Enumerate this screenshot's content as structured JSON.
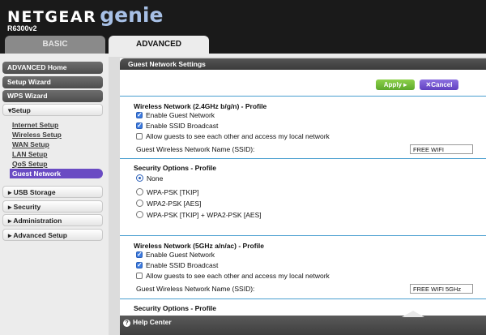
{
  "header": {
    "brand": "NETGEAR",
    "brand_product": "genie",
    "model": "R6300v2",
    "tabs": [
      {
        "label": "BASIC",
        "active": false
      },
      {
        "label": "ADVANCED",
        "active": true
      }
    ]
  },
  "sidebar": {
    "buttons": [
      {
        "label": "ADVANCED Home"
      },
      {
        "label": "Setup Wizard"
      },
      {
        "label": "WPS Wizard"
      }
    ],
    "setup": {
      "label": "▾Setup",
      "items": [
        {
          "label": "Internet Setup"
        },
        {
          "label": "Wireless Setup"
        },
        {
          "label": "WAN Setup"
        },
        {
          "label": "LAN Setup"
        },
        {
          "label": "QoS Setup"
        },
        {
          "label": "Guest Network",
          "active": true
        }
      ]
    },
    "menus": [
      {
        "label": "▸ USB Storage"
      },
      {
        "label": "▸ Security"
      },
      {
        "label": "▸ Administration"
      },
      {
        "label": "▸ Advanced Setup"
      }
    ]
  },
  "main": {
    "title": "Guest Network Settings",
    "apply_label": "Apply ▸",
    "cancel_label": "✕Cancel",
    "profile_24": {
      "title": "Wireless Network (2.4GHz b/g/n) - Profile",
      "enable_guest": "Enable Guest Network",
      "enable_guest_checked": true,
      "enable_ssid": "Enable SSID Broadcast",
      "enable_ssid_checked": true,
      "allow_local": "Allow guests to see each other and access my local network",
      "allow_local_checked": false,
      "ssid_label": "Guest Wireless Network Name (SSID):",
      "ssid_value": "FREE WIFI"
    },
    "security_24": {
      "title": "Security Options - Profile",
      "options": [
        {
          "label": "None",
          "selected": true
        },
        {
          "label": "WPA-PSK [TKIP]",
          "selected": false
        },
        {
          "label": "WPA2-PSK [AES]",
          "selected": false
        },
        {
          "label": "WPA-PSK [TKIP] + WPA2-PSK [AES]",
          "selected": false
        }
      ]
    },
    "profile_5": {
      "title": "Wireless Network (5GHz a/n/ac) - Profile",
      "enable_guest": "Enable Guest Network",
      "enable_guest_checked": true,
      "enable_ssid": "Enable SSID Broadcast",
      "enable_ssid_checked": true,
      "allow_local": "Allow guests to see each other and access my local network",
      "allow_local_checked": false,
      "ssid_label": "Guest Wireless Network Name (SSID):",
      "ssid_value": "FREE WIFI 5GHz"
    },
    "security_5": {
      "title": "Security Options - Profile"
    }
  },
  "footer": {
    "help_label": "Help Center",
    "help_icon": "question-icon"
  },
  "colors": {
    "accent_purple": "#6a4bc3",
    "apply_green": "#6cba33",
    "divider_blue": "#4a9fd0"
  }
}
